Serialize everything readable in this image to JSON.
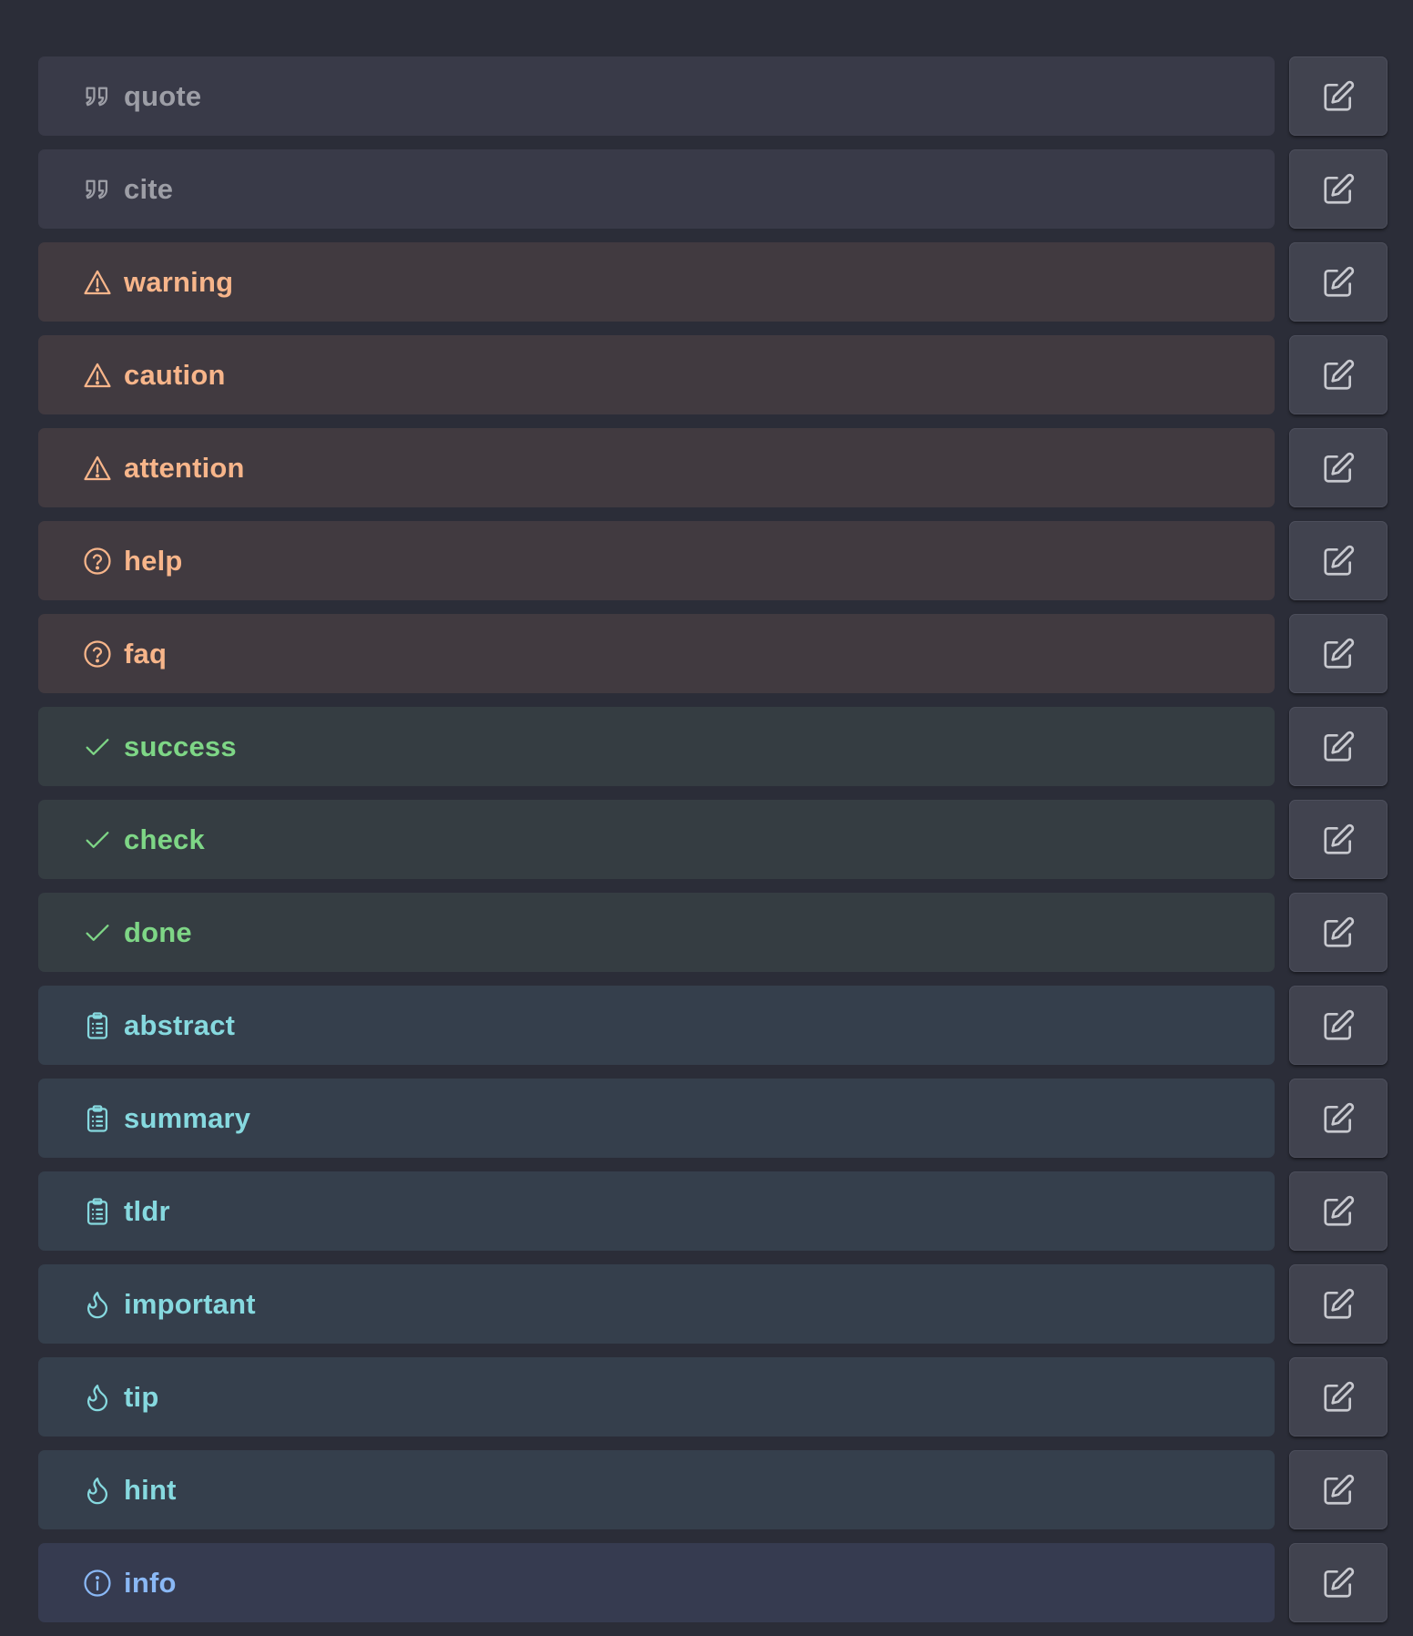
{
  "callouts": [
    {
      "label": "quote",
      "icon": "quote-icon",
      "variant": "gray"
    },
    {
      "label": "cite",
      "icon": "quote-icon",
      "variant": "gray"
    },
    {
      "label": "warning",
      "icon": "warning-triangle-icon",
      "variant": "orange"
    },
    {
      "label": "caution",
      "icon": "warning-triangle-icon",
      "variant": "orange"
    },
    {
      "label": "attention",
      "icon": "warning-triangle-icon",
      "variant": "orange"
    },
    {
      "label": "help",
      "icon": "help-circle-icon",
      "variant": "orange"
    },
    {
      "label": "faq",
      "icon": "help-circle-icon",
      "variant": "orange"
    },
    {
      "label": "success",
      "icon": "check-icon",
      "variant": "green"
    },
    {
      "label": "check",
      "icon": "check-icon",
      "variant": "green"
    },
    {
      "label": "done",
      "icon": "check-icon",
      "variant": "green"
    },
    {
      "label": "abstract",
      "icon": "clipboard-list-icon",
      "variant": "cyan"
    },
    {
      "label": "summary",
      "icon": "clipboard-list-icon",
      "variant": "cyan"
    },
    {
      "label": "tldr",
      "icon": "clipboard-list-icon",
      "variant": "cyan"
    },
    {
      "label": "important",
      "icon": "flame-icon",
      "variant": "cyan"
    },
    {
      "label": "tip",
      "icon": "flame-icon",
      "variant": "cyan"
    },
    {
      "label": "hint",
      "icon": "flame-icon",
      "variant": "cyan"
    },
    {
      "label": "info",
      "icon": "info-circle-icon",
      "variant": "blue"
    }
  ],
  "edit_button_icon": "edit-icon",
  "colors": {
    "background": "#2b2d38",
    "gray": "#9d9ea6",
    "orange": "#f7b58a",
    "green": "#7ed686",
    "cyan": "#86d9df",
    "blue": "#8ab8f5",
    "button_icon": "#c8c9cf"
  }
}
